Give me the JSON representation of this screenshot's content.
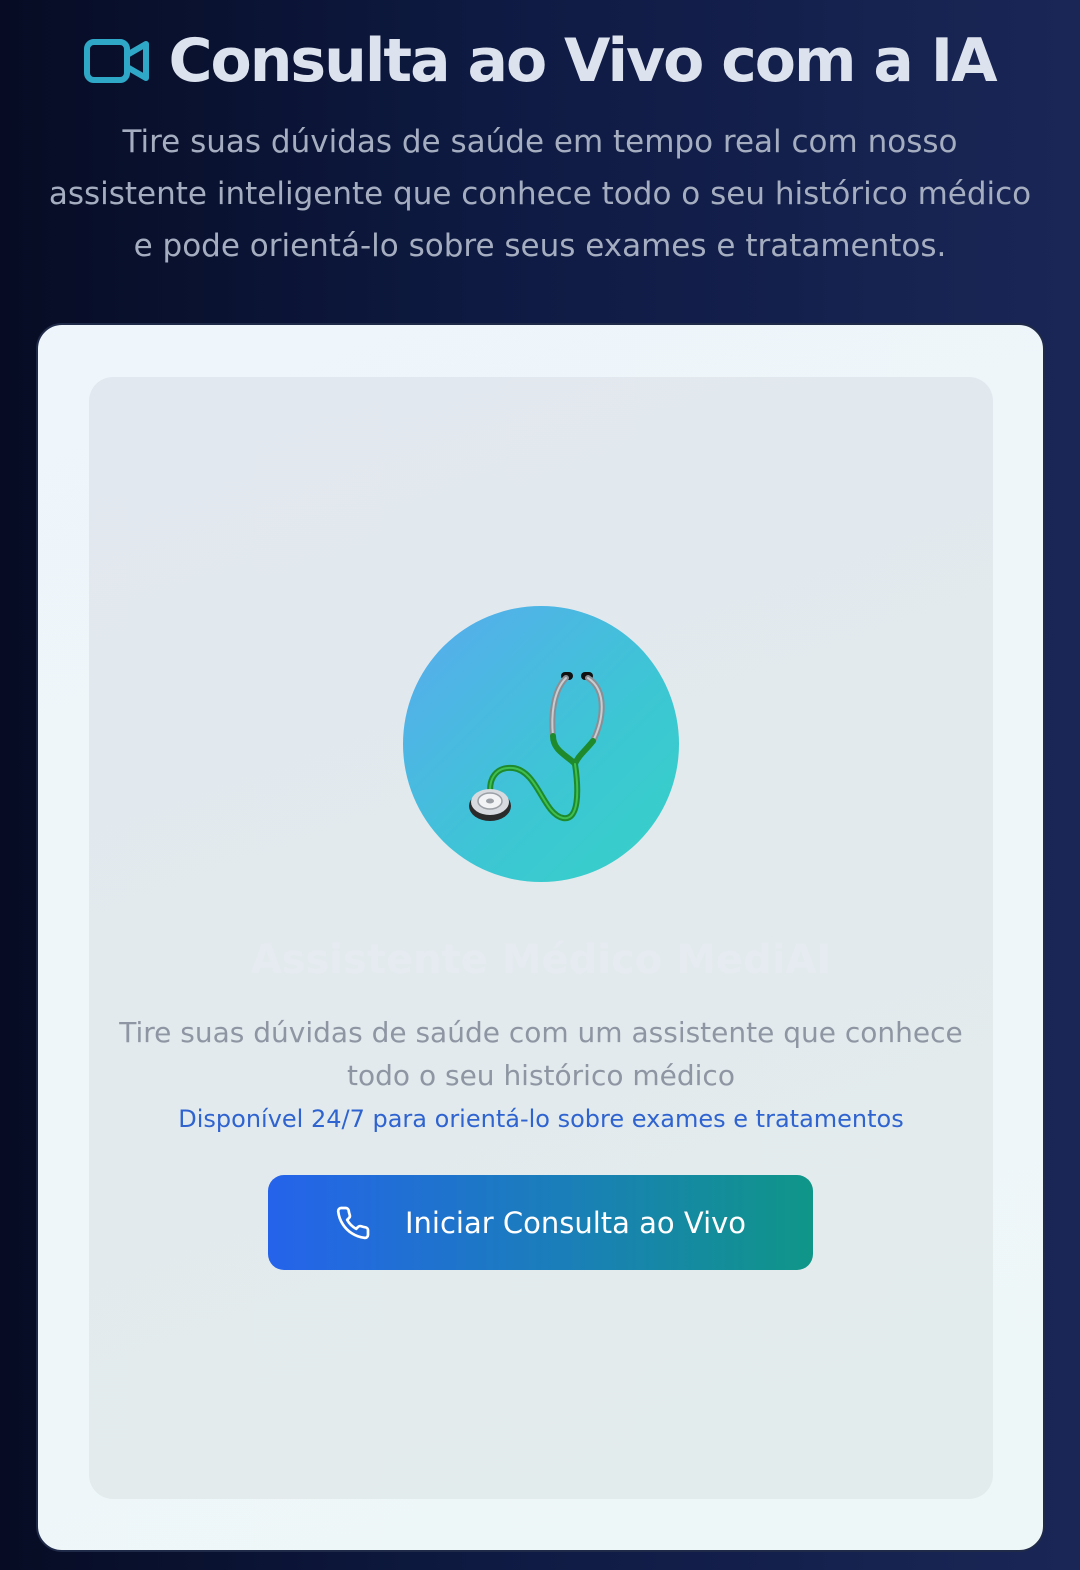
{
  "header": {
    "title_icon": "video-camera-icon",
    "title": "Consulta ao Vivo com a IA",
    "subtitle": "Tire suas dúvidas de saúde em tempo real com nosso assistente inteligente que conhece todo o seu histórico médico e pode orientá-lo sobre seus exames e tratamentos."
  },
  "card": {
    "avatar_icon": "stethoscope-icon",
    "assistant_name": "Assistente Médico MediAI",
    "description": "Tire suas dúvidas de saúde com um assistente que conhece todo o seu histórico médico",
    "availability": "Disponível 24/7 para orientá-lo sobre exames e tratamentos",
    "start_button": {
      "icon": "phone-icon",
      "label": "Iniciar Consulta ao Vivo"
    }
  },
  "colors": {
    "accent_cyan": "#2fa8c8",
    "button_start": "#2563eb",
    "button_end": "#0f9688",
    "availability_text": "#2f64d0"
  }
}
